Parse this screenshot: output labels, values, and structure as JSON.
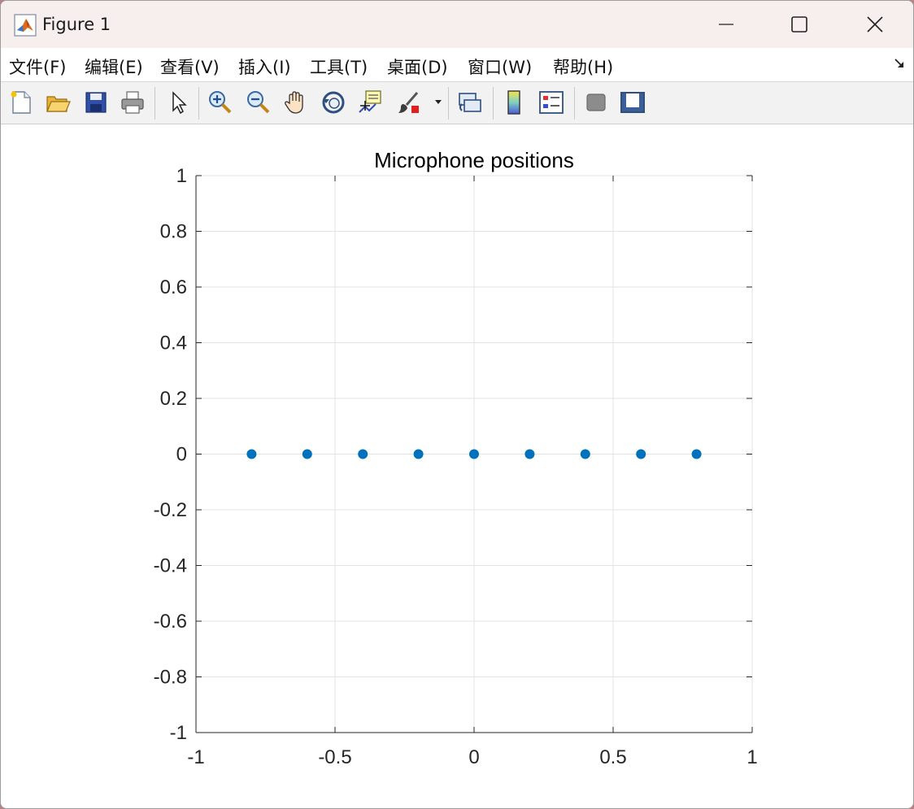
{
  "window": {
    "title": "Figure 1",
    "minimize_icon": "minimize-icon",
    "maximize_icon": "maximize-icon",
    "close_icon": "close-icon"
  },
  "menu": {
    "items": [
      "文件(F)",
      "编辑(E)",
      "查看(V)",
      "插入(I)",
      "工具(T)",
      "桌面(D)",
      "窗口(W)",
      "帮助(H)"
    ]
  },
  "toolbar": {
    "icons": [
      "new-figure-icon",
      "open-file-icon",
      "save-icon",
      "print-icon",
      "select-arrow-icon",
      "zoom-in-icon",
      "zoom-out-icon",
      "pan-hand-icon",
      "rotate-3d-icon",
      "data-cursor-icon",
      "brush-icon",
      "link-plot-icon",
      "colorbar-icon",
      "legend-icon",
      "hide-plot-tools-icon",
      "show-plot-tools-icon"
    ]
  },
  "colors": {
    "marker": "#0072bd",
    "grid": "#e3e3e3",
    "axis": "#262626"
  },
  "chart_data": {
    "type": "scatter",
    "title": "Microphone positions",
    "xlabel": "",
    "ylabel": "",
    "xlim": [
      -1,
      1
    ],
    "ylim": [
      -1,
      1
    ],
    "x_ticks": [
      -1,
      -0.5,
      0,
      0.5,
      1
    ],
    "x_tick_labels": [
      "-1",
      "-0.5",
      "0",
      "0.5",
      "1"
    ],
    "y_ticks": [
      1,
      0.8,
      0.6,
      0.4,
      0.2,
      0,
      -0.2,
      -0.4,
      -0.6,
      -0.8,
      -1
    ],
    "y_tick_labels": [
      "1",
      "0.8",
      "0.6",
      "0.4",
      "0.2",
      "0",
      "-0.2",
      "-0.4",
      "-0.6",
      "-0.8",
      "-1"
    ],
    "grid": true,
    "series": [
      {
        "x": [
          -0.8,
          -0.6,
          -0.4,
          -0.2,
          0,
          0.2,
          0.4,
          0.6,
          0.8
        ],
        "y": [
          0,
          0,
          0,
          0,
          0,
          0,
          0,
          0,
          0
        ]
      }
    ]
  }
}
